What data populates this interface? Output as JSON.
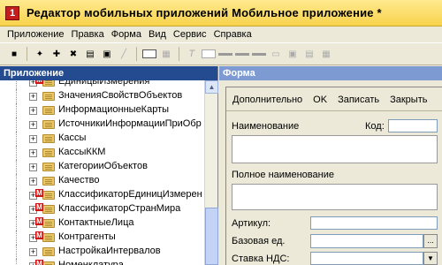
{
  "window": {
    "title": "Редактор мобильных приложений Мобильное приложение *"
  },
  "menu": [
    "Приложение",
    "Правка",
    "Форма",
    "Вид",
    "Сервис",
    "Справка"
  ],
  "left_panel": {
    "title": "Приложение",
    "items": [
      {
        "label": "ЕдиницыИзмерения",
        "marked": true
      },
      {
        "label": "ЗначенияСвойствОбъектов",
        "marked": false
      },
      {
        "label": "ИнформационныеКарты",
        "marked": false
      },
      {
        "label": "ИсточникиИнформацииПриОбр",
        "marked": false
      },
      {
        "label": "Кассы",
        "marked": false
      },
      {
        "label": "КассыККМ",
        "marked": false
      },
      {
        "label": "КатегорииОбъектов",
        "marked": false
      },
      {
        "label": "Качество",
        "marked": false
      },
      {
        "label": "КлассификаторЕдиницИзмерен",
        "marked": true
      },
      {
        "label": "КлассификаторСтранМира",
        "marked": true
      },
      {
        "label": "КонтактныеЛица",
        "marked": true
      },
      {
        "label": "Контрагенты",
        "marked": true
      },
      {
        "label": "НастройкаИнтервалов",
        "marked": false
      },
      {
        "label": "Номенклатура",
        "marked": true
      }
    ]
  },
  "right_panel": {
    "title": "Форма",
    "toolbar": [
      "Дополнительно",
      "OK",
      "Записать",
      "Закрыть"
    ],
    "fields": {
      "name": "Наименование",
      "code": "Код:",
      "full_name": "Полное наименование",
      "article": "Артикул:",
      "base_unit": "Базовая ед.",
      "vat_rate": "Ставка НДС:"
    },
    "select_button": "...",
    "combo_arrow": "▼"
  },
  "colors": {
    "title_bar": "#f7d34b",
    "tree_header": "#244a8f",
    "form_header": "#7d9ad2"
  }
}
